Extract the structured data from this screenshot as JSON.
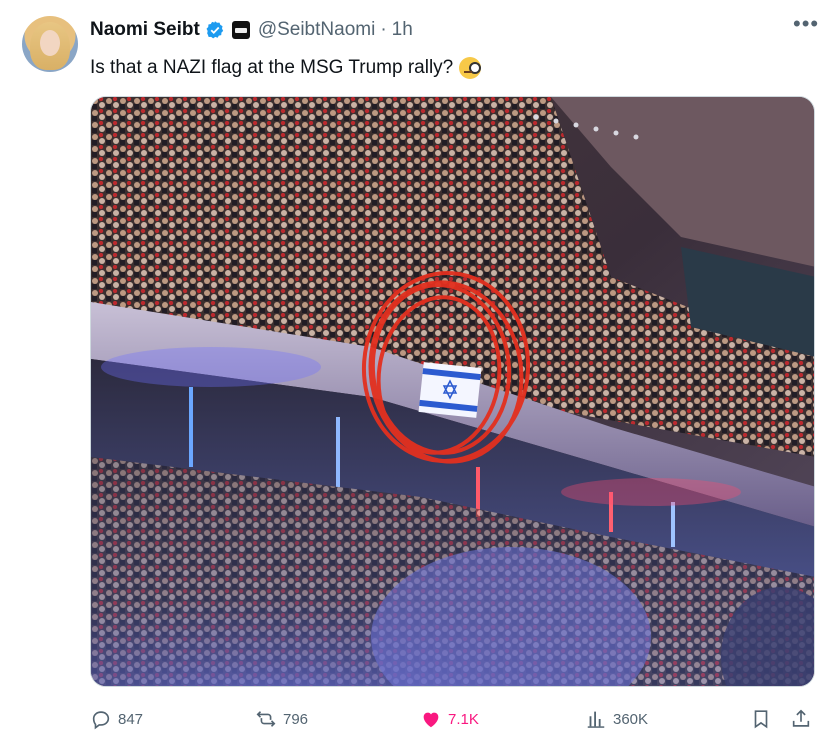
{
  "author": {
    "display_name": "Naomi Seibt",
    "handle": "@SeibtNaomi",
    "separator": "·",
    "time": "1h",
    "verified_icon": "verified-badge-icon",
    "affiliation_icon": "affiliation-badge-icon"
  },
  "tweet": {
    "text": "Is that a NAZI flag at the MSG Trump rally?",
    "emoji": "face-with-monocle"
  },
  "media": {
    "description_icon": "photo"
  },
  "actions": {
    "replies": "847",
    "reposts": "796",
    "likes": "7.1K",
    "views": "360K"
  },
  "colors": {
    "text": "#0f1419",
    "secondary": "#536471",
    "like": "#f91880",
    "verified": "#1d9bf0"
  }
}
